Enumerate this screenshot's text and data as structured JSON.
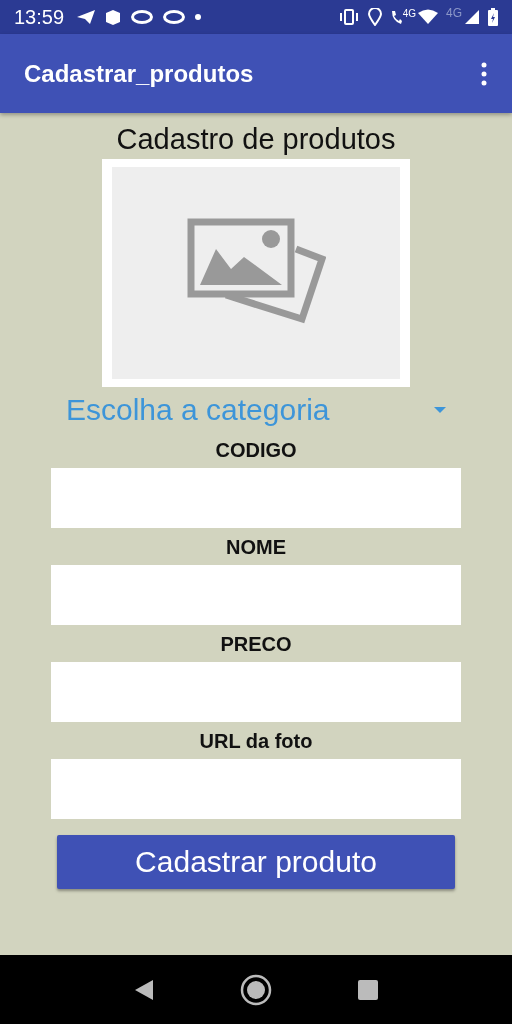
{
  "status_bar": {
    "time": "13:59",
    "call_network": "4G",
    "signal_network": "4G"
  },
  "app_bar": {
    "title": "Cadastrar_produtos"
  },
  "form": {
    "heading": "Cadastro de produtos",
    "image": {
      "kind": "placeholder"
    },
    "spinner": {
      "value": "Escolha a categoria"
    },
    "fields": [
      {
        "label": "CODIGO"
      },
      {
        "label": "NOME"
      },
      {
        "label": "PRECO"
      },
      {
        "label": "URL da foto"
      }
    ],
    "submit": "Cadastrar produto"
  }
}
